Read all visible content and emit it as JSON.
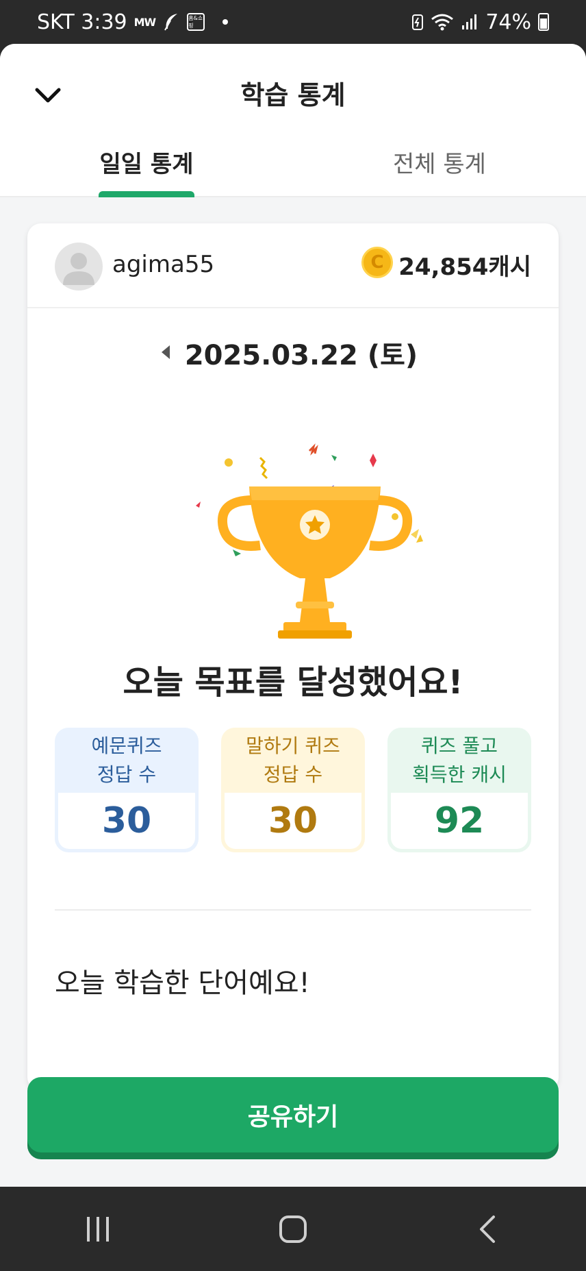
{
  "status_bar": {
    "carrier_time": "SKT 3:39",
    "mini_label": "MW",
    "box_label": "홈&쇼핑",
    "battery": "74%"
  },
  "header": {
    "title": "학습 통계",
    "back_icon": "chevron-down-icon"
  },
  "tabs": [
    {
      "label": "일일 통계",
      "active": true
    },
    {
      "label": "전체 통계",
      "active": false
    }
  ],
  "profile": {
    "username": "agima55",
    "cash": "24,854캐시",
    "coin_icon": "coin-icon"
  },
  "date": {
    "label": "2025.03.22 (토)"
  },
  "goal_message": "오늘 목표를 달성했어요!",
  "stats": [
    {
      "label_line1": "예문퀴즈",
      "label_line2": "정답 수",
      "value": "30",
      "color": "#2b5d9b"
    },
    {
      "label_line1": "말하기 퀴즈",
      "label_line2": "정답 수",
      "value": "30",
      "color": "#b07a10"
    },
    {
      "label_line1": "퀴즈 풀고",
      "label_line2": "획득한 캐시",
      "value": "92",
      "color": "#1d8a55"
    }
  ],
  "words_title": "오늘 학습한 단어예요!",
  "share_button": "공유하기",
  "colors": {
    "accent": "#1da865",
    "tab_indicator": "#1fa86a",
    "trophy": "#ffb020"
  }
}
